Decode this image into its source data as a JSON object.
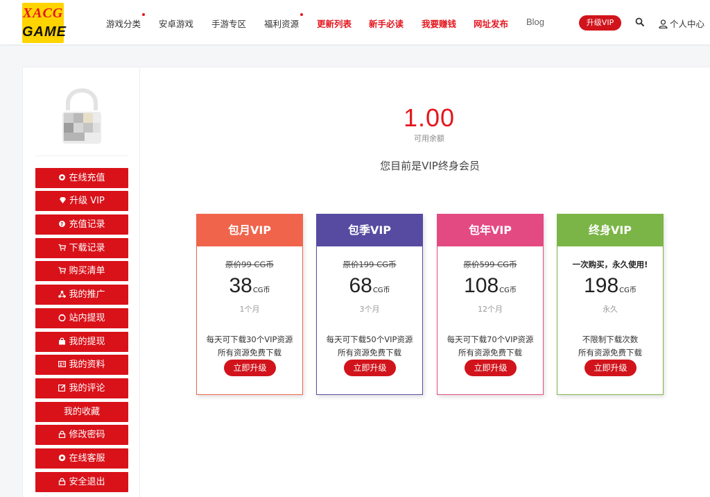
{
  "logo": {
    "line1": "XACG",
    "line2": "GAME"
  },
  "nav": {
    "items": [
      {
        "label": "游戏分类"
      },
      {
        "label": "安卓游戏"
      },
      {
        "label": "手游专区"
      },
      {
        "label": "福利资源"
      },
      {
        "label": "更新列表"
      },
      {
        "label": "新手必读"
      },
      {
        "label": "我要赚钱"
      },
      {
        "label": "网址发布"
      },
      {
        "label": "Blog"
      }
    ],
    "vip_button": "升级VIP",
    "user_center": "个人中心"
  },
  "sidebar": {
    "menu": [
      {
        "label": "在线充值",
        "icon": "coin-icon"
      },
      {
        "label": "升级 VIP",
        "icon": "diamond-icon"
      },
      {
        "label": "充值记录",
        "icon": "record-icon"
      },
      {
        "label": "下载记录",
        "icon": "cart-icon"
      },
      {
        "label": "购买清单",
        "icon": "cart-icon"
      },
      {
        "label": "我的推广",
        "icon": "share-icon"
      },
      {
        "label": "站内提现",
        "icon": "withdraw-icon"
      },
      {
        "label": "我的提现",
        "icon": "bag-icon"
      },
      {
        "label": "我的资料",
        "icon": "profile-card-icon"
      },
      {
        "label": "我的评论",
        "icon": "edit-icon"
      },
      {
        "label": "我的收藏",
        "icon": ""
      },
      {
        "label": "修改密码",
        "icon": "lock-icon"
      },
      {
        "label": "在线客服",
        "icon": "support-icon"
      },
      {
        "label": "安全退出",
        "icon": "lock-icon"
      }
    ]
  },
  "account": {
    "balance": "1.00",
    "balance_label": "可用余额",
    "status": "您目前是VIP终身会员"
  },
  "plans": [
    {
      "title": "包月VIP",
      "original": "原价99 CG币",
      "price": "38",
      "unit": "CG币",
      "period": "1个月",
      "feature1": "每天可下载30个VIP资源",
      "feature2": "所有资源免费下载",
      "button": "立即升级",
      "color": "#f0644c"
    },
    {
      "title": "包季VIP",
      "original": "原价199 CG币",
      "price": "68",
      "unit": "CG币",
      "period": "3个月",
      "feature1": "每天可下载50个VIP资源",
      "feature2": "所有资源免费下载",
      "button": "立即升级",
      "color": "#564ba0"
    },
    {
      "title": "包年VIP",
      "original": "原价599 CG币",
      "price": "108",
      "unit": "CG币",
      "period": "12个月",
      "feature1": "每天可下载70个VIP资源",
      "feature2": "所有资源免费下载",
      "button": "立即升级",
      "color": "#e44a82"
    },
    {
      "title": "终身VIP",
      "original": "一次购买，永久使用!",
      "price": "198",
      "unit": "CG币",
      "period": "永久",
      "feature1": "不限制下载次数",
      "feature2": "所有资源免费下载",
      "button": "立即升级",
      "color": "#7bb547"
    }
  ],
  "colors": {
    "accent": "#d9121a",
    "logo_bg": "#ffd400"
  }
}
